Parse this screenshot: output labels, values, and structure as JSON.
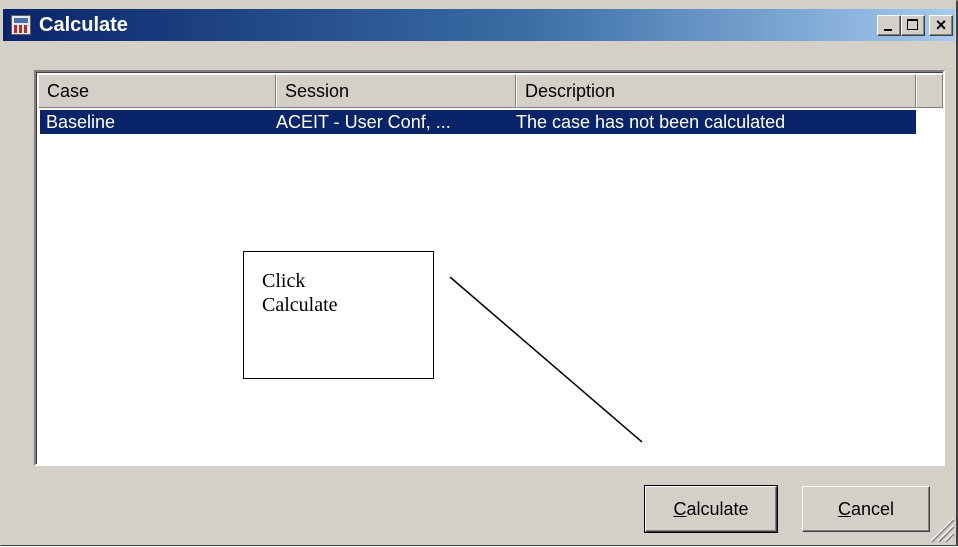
{
  "window": {
    "title": "Calculate",
    "icon": "calculator-icon",
    "title_buttons": [
      "minimize",
      "maximize",
      "close"
    ],
    "close_glyph": "×"
  },
  "table": {
    "columns": [
      "Case",
      "Session",
      "Description"
    ],
    "rows": [
      {
        "case": "Baseline",
        "session": "ACEIT - User Conf, ...",
        "description": "The case has not been calculated",
        "selected": true
      }
    ]
  },
  "annotation": {
    "line1": "Click",
    "line2": "Calculate"
  },
  "buttons": {
    "calculate": {
      "hotkey": "C",
      "rest": "alculate"
    },
    "cancel": {
      "hotkey": "C",
      "rest": "ancel"
    }
  },
  "colors": {
    "titlebar_start": "#0a246a",
    "titlebar_end": "#a6caf0",
    "selection": "#0a246a",
    "face": "#d4d0c8"
  }
}
